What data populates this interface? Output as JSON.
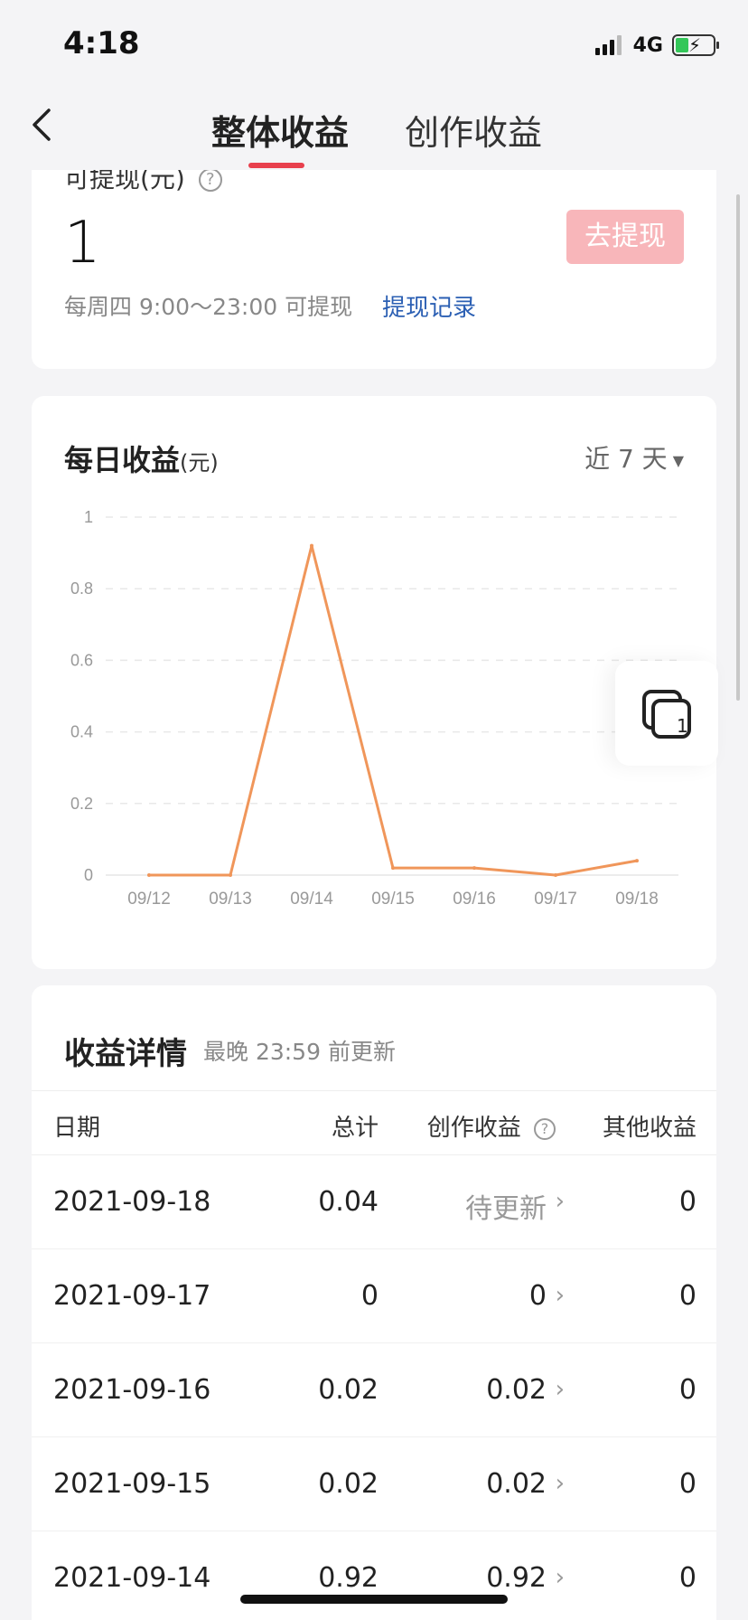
{
  "status_bar": {
    "time": "4:18",
    "network": "4G"
  },
  "nav": {
    "tabs": [
      {
        "label": "整体收益"
      },
      {
        "label": "创作收益"
      }
    ]
  },
  "withdraw": {
    "label": "可提现(元)",
    "amount": "1",
    "button": "去提现",
    "note": "每周四 9:00～23:00 可提现",
    "record_link": "提现记录"
  },
  "daily": {
    "title": "每日收益",
    "unit": "(元)",
    "range": "近 7 天"
  },
  "chart_data": {
    "type": "line",
    "categories": [
      "09/12",
      "09/13",
      "09/14",
      "09/15",
      "09/16",
      "09/17",
      "09/18"
    ],
    "values": [
      0,
      0,
      0.92,
      0.02,
      0.02,
      0,
      0.04
    ],
    "ylim": [
      0,
      1
    ],
    "yticks": [
      "1",
      "0.8",
      "0.6",
      "0.4",
      "0.2",
      "0"
    ],
    "grid": true,
    "line_color": "#f0965a"
  },
  "floating": {
    "badge": "1"
  },
  "detail": {
    "title": "收益详情",
    "subtitle": "最晚 23:59 前更新",
    "headers": {
      "date": "日期",
      "total": "总计",
      "creation": "创作收益",
      "other": "其他收益"
    },
    "rows": [
      {
        "date": "2021-09-18",
        "total": "0.04",
        "creation": "待更新",
        "other": "0"
      },
      {
        "date": "2021-09-17",
        "total": "0",
        "creation": "0",
        "other": "0"
      },
      {
        "date": "2021-09-16",
        "total": "0.02",
        "creation": "0.02",
        "other": "0"
      },
      {
        "date": "2021-09-15",
        "total": "0.02",
        "creation": "0.02",
        "other": "0"
      },
      {
        "date": "2021-09-14",
        "total": "0.92",
        "creation": "0.92",
        "other": "0"
      }
    ]
  },
  "colors": {
    "accent": "#e8404d",
    "withdraw_button": "#f8b6ba",
    "link": "#2b5fb3"
  }
}
